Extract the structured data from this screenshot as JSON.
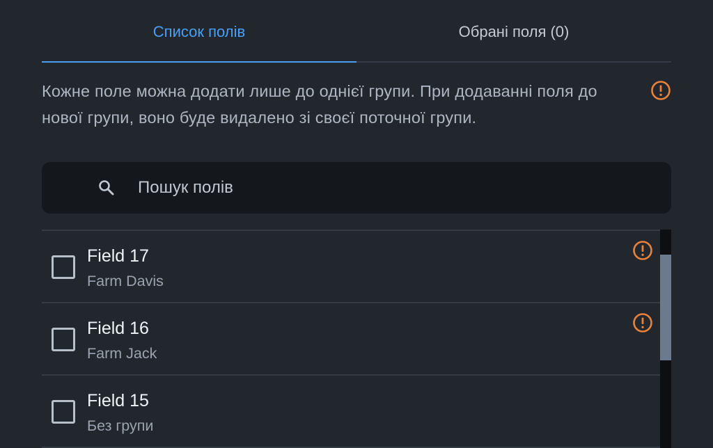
{
  "tabs": [
    {
      "label": "Список полів",
      "active": true
    },
    {
      "label": "Обрані поля (0)",
      "active": false
    }
  ],
  "notice": {
    "text": "Кожне поле можна додати лише до однієї групи. При додаванні поля до нової групи, воно буде видалено зі своєї поточної групи.",
    "icon": "warning-circle-icon"
  },
  "search": {
    "placeholder": "Пошук полів",
    "value": "",
    "icon": "search-icon"
  },
  "fields": [
    {
      "title": "Field 17",
      "subtitle": "Farm Davis",
      "warning": true,
      "checked": false
    },
    {
      "title": "Field 16",
      "subtitle": "Farm Jack",
      "warning": true,
      "checked": false
    },
    {
      "title": "Field 15",
      "subtitle": "Без групи",
      "warning": false,
      "checked": false
    }
  ],
  "colors": {
    "accent": "#4a9ff5",
    "warning": "#e8823a",
    "background": "#22272e",
    "search_background": "#14171c"
  }
}
